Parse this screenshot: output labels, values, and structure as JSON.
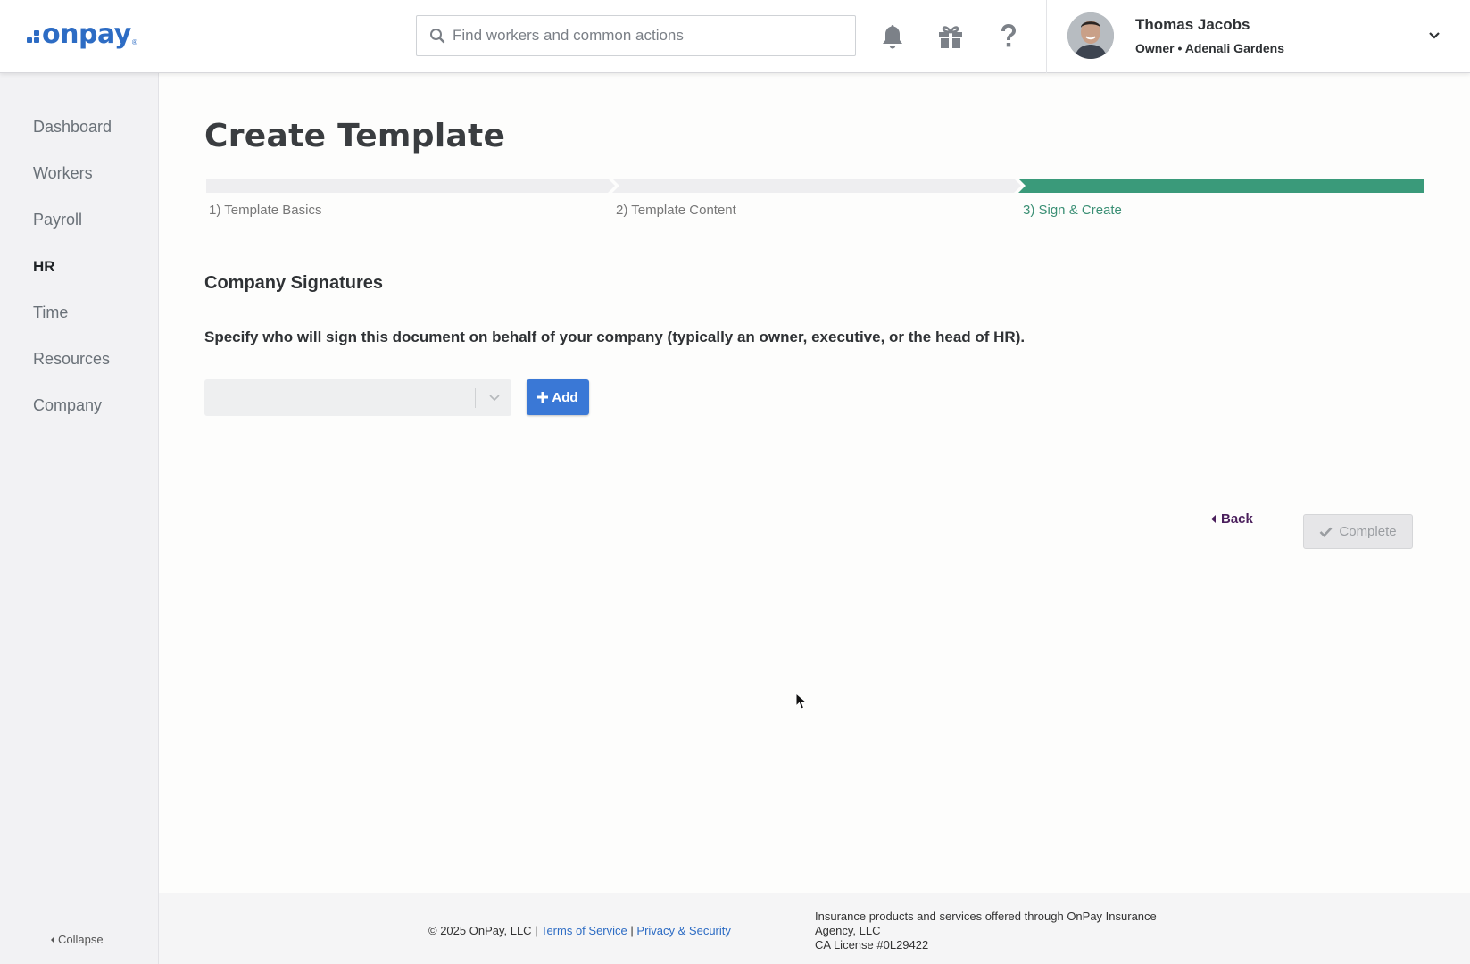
{
  "header": {
    "logo_text": "onpay",
    "logo_reg": "®",
    "search_placeholder": "Find workers and common actions",
    "icons": [
      "bell-icon",
      "gift-icon",
      "help-icon"
    ],
    "user": {
      "name": "Thomas Jacobs",
      "role": "Owner • Adenali Gardens"
    }
  },
  "sidebar": {
    "items": [
      {
        "label": "Dashboard",
        "active": false
      },
      {
        "label": "Workers",
        "active": false
      },
      {
        "label": "Payroll",
        "active": false
      },
      {
        "label": "HR",
        "active": true
      },
      {
        "label": "Time",
        "active": false
      },
      {
        "label": "Resources",
        "active": false
      },
      {
        "label": "Company",
        "active": false
      }
    ],
    "collapse_label": "Collapse"
  },
  "main": {
    "title": "Create Template",
    "steps": [
      {
        "label": "1) Template Basics",
        "active": false
      },
      {
        "label": "2) Template Content",
        "active": false
      },
      {
        "label": "3) Sign & Create",
        "active": true
      }
    ],
    "section_title": "Company Signatures",
    "section_desc": "Specify who will sign this document on behalf of your company (typically an owner, executive, or the head of HR).",
    "select_value": "",
    "add_label": "Add",
    "back_label": "Back",
    "complete_label": "Complete"
  },
  "footer": {
    "copyright": "© 2025 OnPay, LLC |",
    "terms": "Terms of Service",
    "sep": "|",
    "privacy": "Privacy & Security",
    "insurance_line1": "Insurance products and services offered through OnPay Insurance",
    "insurance_line2": "Agency, LLC",
    "insurance_line3": "CA License #0L29422"
  },
  "colors": {
    "brand": "#2d6cc4",
    "step_active": "#3a9a7a",
    "step_inactive": "#eeeef0",
    "add_button": "#3a78d6",
    "back_text": "#4a1f5c"
  }
}
